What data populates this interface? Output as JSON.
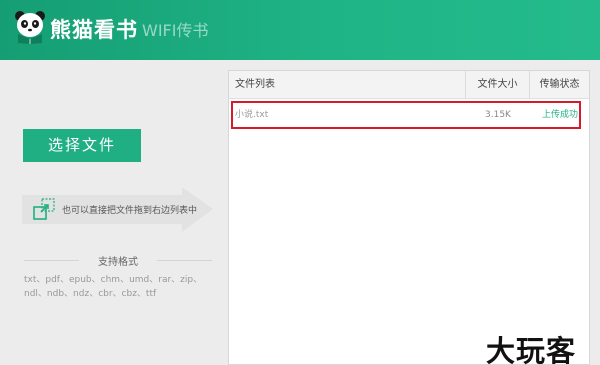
{
  "header": {
    "brand": "熊猫看书",
    "subtitle": "WIFI传书",
    "bg_color": "#1fb485"
  },
  "left": {
    "select_button": "选择文件",
    "drag_hint": "也可以直接把文件拖到右边列表中",
    "formats_title": "支持格式",
    "formats": "txt、pdf、epub、chm、umd、rar、zip、ndl、ndb、ndz、cbr、cbz、ttf"
  },
  "file_list": {
    "columns": [
      "文件列表",
      "文件大小",
      "传输状态"
    ],
    "rows": [
      {
        "name": "小说.txt",
        "size": "3.15K",
        "status": "上传成功"
      }
    ]
  },
  "watermark": "大玩客",
  "colors": {
    "accent": "#1faf82",
    "highlight_border": "#d6192b"
  }
}
